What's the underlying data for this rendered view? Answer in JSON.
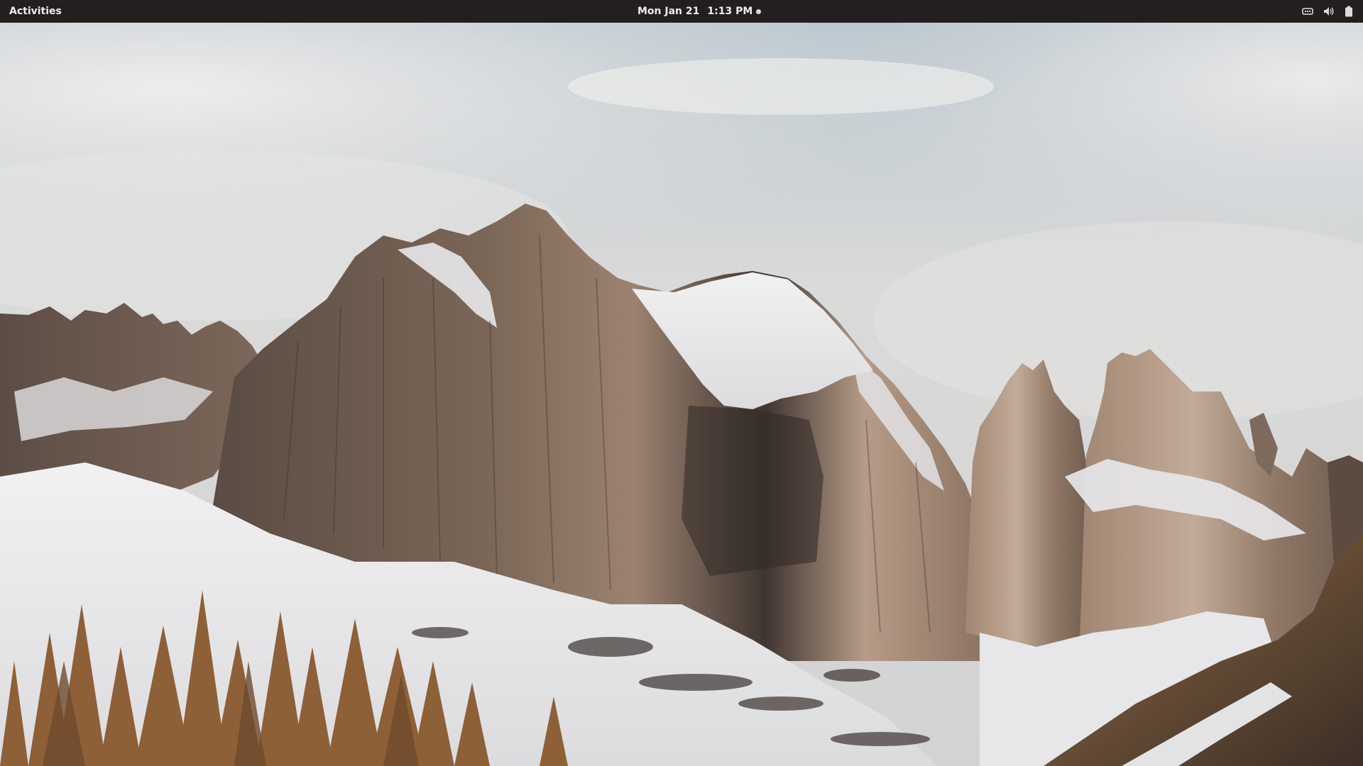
{
  "topbar": {
    "activities_label": "Activities",
    "date": "Mon Jan 21",
    "time": "1:13 PM",
    "tray": {
      "network_icon": "network-wired-icon",
      "volume_icon": "speaker-volume-icon",
      "battery_icon": "battery-icon"
    }
  },
  "wallpaper": {
    "description_icon": "mountain-wallpaper",
    "colors": {
      "sky": "#c9cfd3",
      "cloud": "#e4e3e1",
      "rock_light": "#b39a86",
      "rock_dark": "#4a3f38",
      "snow": "#e9e9ea",
      "larch": "#9a6a3c"
    }
  }
}
